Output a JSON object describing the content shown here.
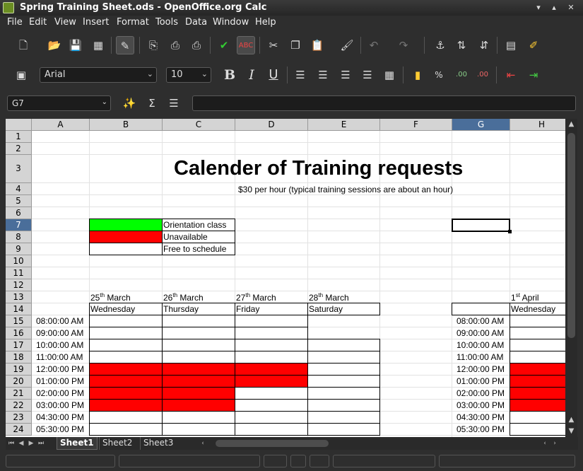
{
  "window": {
    "title": "Spring Training Sheet.ods - OpenOffice.org Calc",
    "controls": [
      "▾",
      "▴",
      "✕"
    ]
  },
  "menu": [
    "File",
    "Edit",
    "View",
    "Insert",
    "Format",
    "Tools",
    "Data",
    "Window",
    "Help"
  ],
  "toolbar_icons": [
    "new-icon",
    "open-icon",
    "save-icon",
    "edit-file-icon",
    "pdf-icon",
    "print-icon",
    "print-preview-icon",
    "spellcheck-icon",
    "autospell-icon",
    "cut-icon",
    "copy-icon",
    "paste-icon",
    "clone-icon",
    "undo-icon",
    "redo-icon",
    "hyperlink-icon",
    "sort-asc-icon",
    "sort-desc-icon",
    "chart-icon",
    "draw-icon"
  ],
  "formatting": {
    "font_name": "Arial",
    "font_size": "10",
    "bold_label": "B",
    "italic_label": "I",
    "underline_label": "U"
  },
  "formula_bar": {
    "name_box": "G7",
    "formula": ""
  },
  "columns": [
    "A",
    "B",
    "C",
    "D",
    "E",
    "F",
    "G",
    "H"
  ],
  "selected_column": "G",
  "rows": [
    "1",
    "2",
    "3",
    "4",
    "5",
    "6",
    "7",
    "8",
    "9",
    "10",
    "11",
    "12",
    "13",
    "14",
    "15",
    "16",
    "17",
    "18",
    "19",
    "20",
    "21",
    "22",
    "23",
    "24"
  ],
  "selected_row": "7",
  "sheet": {
    "title": "Calender of Training requests",
    "subtitle": "$30 per hour (typical training sessions are about an hour)",
    "legend": [
      {
        "label": "Orientation class",
        "color": "#00ff00"
      },
      {
        "label": "Unavailable",
        "color": "#ff0000"
      },
      {
        "label": "Free to schedule",
        "color": "#ffffff"
      }
    ],
    "dates": [
      {
        "day": "25",
        "sup": "th",
        "month": "March",
        "weekday": "Wednesday"
      },
      {
        "day": "26",
        "sup": "th",
        "month": "March",
        "weekday": "Thursday"
      },
      {
        "day": "27",
        "sup": "th",
        "month": "March",
        "weekday": "Friday"
      },
      {
        "day": "28",
        "sup": "th",
        "month": "March",
        "weekday": "Saturday"
      },
      {
        "day": "1",
        "sup": "st",
        "month": "April",
        "weekday": "Wednesday"
      }
    ],
    "times": [
      "08:00:00 AM",
      "09:00:00 AM",
      "10:00:00 AM",
      "11:00:00 AM",
      "12:00:00 PM",
      "01:00:00 PM",
      "02:00:00 PM",
      "03:00:00 PM",
      "04:30:00 PM",
      "05:30:00 PM"
    ]
  },
  "sheet_tabs": [
    "Sheet1",
    "Sheet2",
    "Sheet3"
  ],
  "active_sheet": "Sheet1"
}
